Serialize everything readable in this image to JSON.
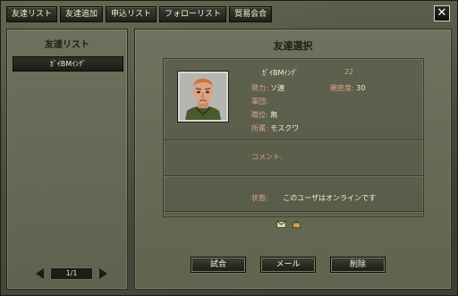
{
  "tabs": [
    {
      "label": "友達リスト"
    },
    {
      "label": "友達追加"
    },
    {
      "label": "申込リスト"
    },
    {
      "label": "フォローリスト"
    },
    {
      "label": "貿易会合"
    }
  ],
  "close_label": "✕",
  "left": {
    "title": "友達リスト",
    "friends": [
      {
        "name": "ｶﾞｲBMｲﾝｸﾞ"
      }
    ],
    "pager": {
      "text": "1/1"
    }
  },
  "right": {
    "title": "友達選択",
    "name": "ｶﾞｲBMｲﾝｸﾞ",
    "level": "22",
    "attrs": {
      "faction_label": "勢力:",
      "faction_value": "ソ連",
      "intimacy_label": "親密度:",
      "intimacy_value": "30",
      "army_label": "軍団:",
      "army_value": "",
      "rank_label": "職位:",
      "rank_value": "無",
      "location_label": "所属:",
      "location_value": "モスクワ"
    },
    "comment_label": "コメント:",
    "status_label": "状態:",
    "status_value": "このユーザはオンラインです"
  },
  "buttons": {
    "challenge": "試合",
    "mail": "メール",
    "delete": "削除"
  },
  "colors": {
    "panel_bg": "#6e725e",
    "label_accent": "#d9a58a",
    "text_light": "#f5f0d8"
  }
}
